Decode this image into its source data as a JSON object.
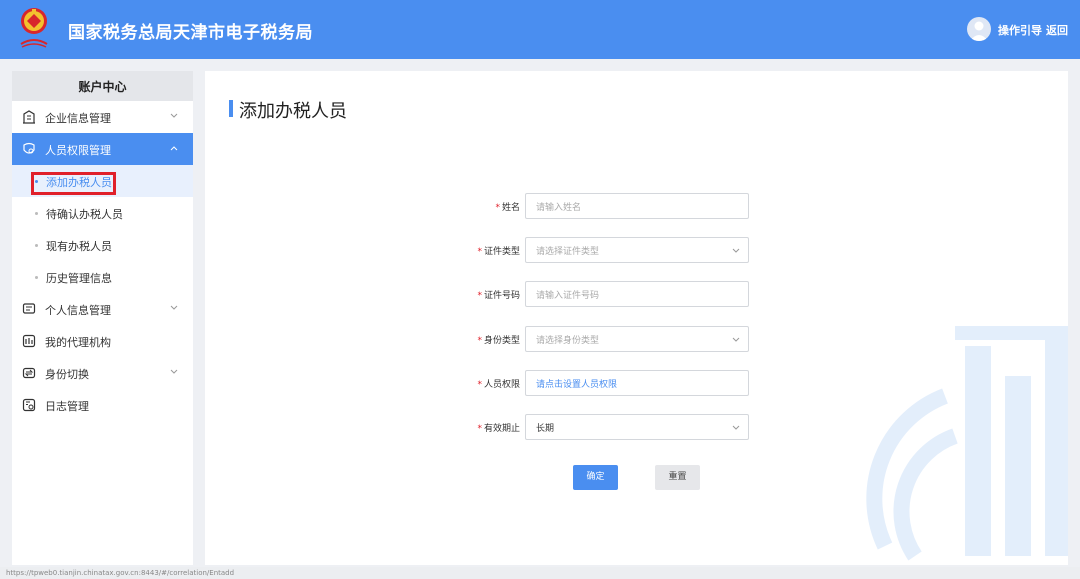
{
  "header": {
    "title": "国家税务总局天津市电子税务局",
    "guide_label": "操作引导",
    "back_label": "返回"
  },
  "sidebar": {
    "title": "账户中心",
    "items": [
      {
        "label": "企业信息管理",
        "icon": "building-icon",
        "expandable": true,
        "expanded": false
      },
      {
        "label": "人员权限管理",
        "icon": "user-shield-icon",
        "expandable": true,
        "expanded": true,
        "active": true,
        "children": [
          {
            "label": "添加办税人员",
            "active": true
          },
          {
            "label": "待确认办税人员"
          },
          {
            "label": "现有办税人员"
          },
          {
            "label": "历史管理信息"
          }
        ]
      },
      {
        "label": "个人信息管理",
        "icon": "id-card-icon",
        "expandable": true,
        "expanded": false
      },
      {
        "label": "我的代理机构",
        "icon": "agency-icon",
        "expandable": false
      },
      {
        "label": "身份切换",
        "icon": "switch-icon",
        "expandable": true,
        "expanded": false
      },
      {
        "label": "日志管理",
        "icon": "log-icon",
        "expandable": false
      }
    ]
  },
  "main": {
    "page_title": "添加办税人员",
    "form": {
      "name": {
        "label": "姓名",
        "placeholder": "请输入姓名"
      },
      "id_type": {
        "label": "证件类型",
        "placeholder": "请选择证件类型"
      },
      "id_number": {
        "label": "证件号码",
        "placeholder": "请输入证件号码"
      },
      "identity_type": {
        "label": "身份类型",
        "placeholder": "请选择身份类型"
      },
      "permission": {
        "label": "人员权限",
        "link_text": "请点击设置人员权限"
      },
      "validity": {
        "label": "有效期止",
        "value": "长期"
      }
    },
    "confirm_label": "确定",
    "reset_label": "重置"
  },
  "status_bar": {
    "url": "https://tpweb0.tianjin.chinatax.gov.cn:8443/#/correlation/Entadd"
  },
  "colors": {
    "accent": "#4a8ef0",
    "highlight_box": "#e0202a",
    "required": "#e0202a"
  }
}
